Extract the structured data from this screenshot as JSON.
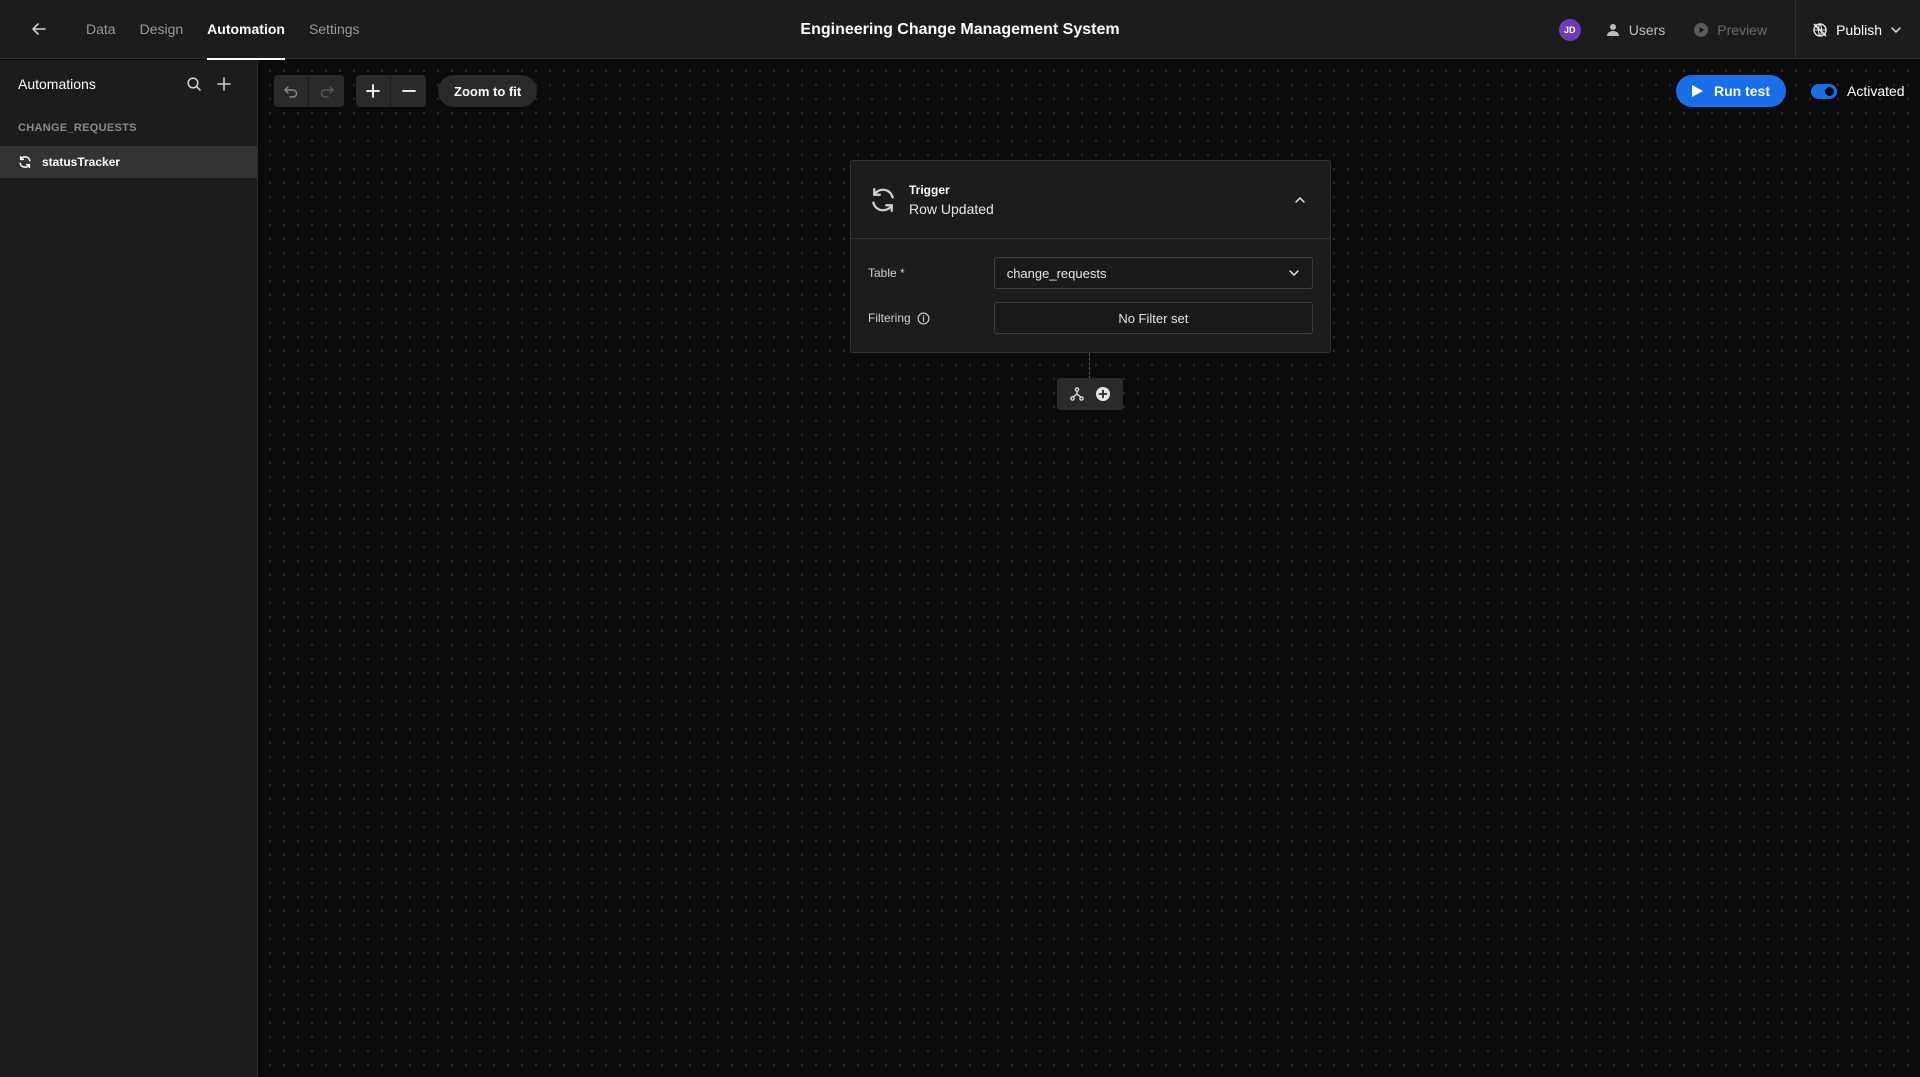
{
  "app": {
    "title": "Engineering Change Management System"
  },
  "nav": {
    "tabs": [
      {
        "label": "Data",
        "active": false
      },
      {
        "label": "Design",
        "active": false
      },
      {
        "label": "Automation",
        "active": true
      },
      {
        "label": "Settings",
        "active": false
      }
    ]
  },
  "topright": {
    "avatar_initials": "JD",
    "users_label": "Users",
    "preview_label": "Preview",
    "publish_label": "Publish"
  },
  "sidebar": {
    "title": "Automations",
    "group_label": "CHANGE_REQUESTS",
    "items": [
      {
        "label": "statusTracker",
        "icon": "refresh-icon",
        "selected": true
      }
    ]
  },
  "toolbar": {
    "zoom_fit_label": "Zoom to fit",
    "run_test_label": "Run test",
    "activated_label": "Activated",
    "activated": true
  },
  "trigger": {
    "kind": "Trigger",
    "name": "Row Updated",
    "table_label": "Table *",
    "table_value": "change_requests",
    "filtering_label": "Filtering",
    "filter_value": "No Filter set"
  },
  "colors": {
    "accent": "#1a6ee8",
    "avatar": "#6f3bb8",
    "background": "#0b0b0b",
    "panel": "#1c1c1c"
  }
}
